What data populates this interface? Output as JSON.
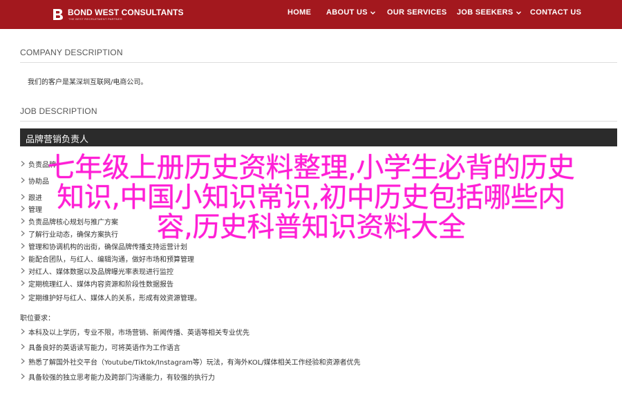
{
  "header": {
    "brand_name": "BOND WEST CONSULTANTS",
    "brand_tagline": "THE BEST RECRUITMENT PARTNER",
    "nav": [
      {
        "label": "HOME"
      },
      {
        "label": "ABOUT US",
        "has_dropdown": true
      },
      {
        "label": "OUR SERVICES"
      },
      {
        "label": "JOB SEEKERS",
        "has_dropdown": true
      },
      {
        "label": "CONTACT US"
      }
    ],
    "colors": {
      "navbar_bg": "#a3181e",
      "nav_text": "#ffffff"
    }
  },
  "company": {
    "heading": "COMPANY DESCRIPTION",
    "text": "我们的客户是某深圳互联网/电商公司。"
  },
  "job": {
    "heading": "JOB DESCRIPTION",
    "title": "品牌营销负责人",
    "duties_partial": [
      "负责品牌",
      "协助品",
      "跟进",
      "管理"
    ],
    "duties": [
      "负责品牌核心规划与推广方案",
      "了解行业动态，确保方案执行",
      "管理和协调机构的出街，确保品牌传播支持运营计划",
      "能配合团队，与红人、编辑沟通，做好市场和预算管理",
      "对红人、媒体数据以及品牌曝光率表现进行监控",
      "定期梳理红人、媒体内容资源和阶段性数据报告",
      "定期维护好与红人、媒体人的关系，形成有效资源管理。"
    ],
    "requirements_heading": "职位要求：",
    "requirements": [
      "本科及以上学历，专业不限，市场营销、新闻传播、英语等相关专业优先",
      "具备良好的英语读写能力，可将英语作为工作语言",
      "熟悉了解国外社交平台（Youtube/Tiktok/Instagram等）玩法，有海外KOL/媒体相关工作经验和资源者优先",
      "具备较强的独立思考能力及跨部门沟通能力，有较强的执行力"
    ]
  },
  "overlay": {
    "lines": [
      "七年级上册历史资料整理,小学生必背的历史",
      "知识,中国小知识常识,初中历史包括哪些内",
      "容,历史科普知识资料大全"
    ],
    "color": "#ff1ed5"
  },
  "icons": {
    "logo": "bw-logo-icon",
    "bullet": "arrow-bullet-icon",
    "dropdown": "chevron-down-icon"
  }
}
